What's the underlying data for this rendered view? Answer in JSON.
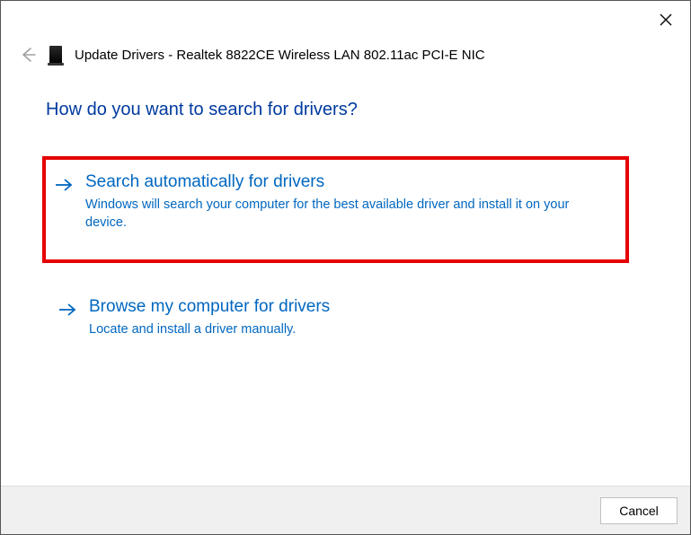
{
  "window_title": "Update Drivers - Realtek 8822CE Wireless LAN 802.11ac PCI-E NIC",
  "heading": "How do you want to search for drivers?",
  "options": [
    {
      "title": "Search automatically for drivers",
      "description": "Windows will search your computer for the best available driver and install it on your device."
    },
    {
      "title": "Browse my computer for drivers",
      "description": "Locate and install a driver manually."
    }
  ],
  "footer": {
    "cancel_label": "Cancel"
  }
}
